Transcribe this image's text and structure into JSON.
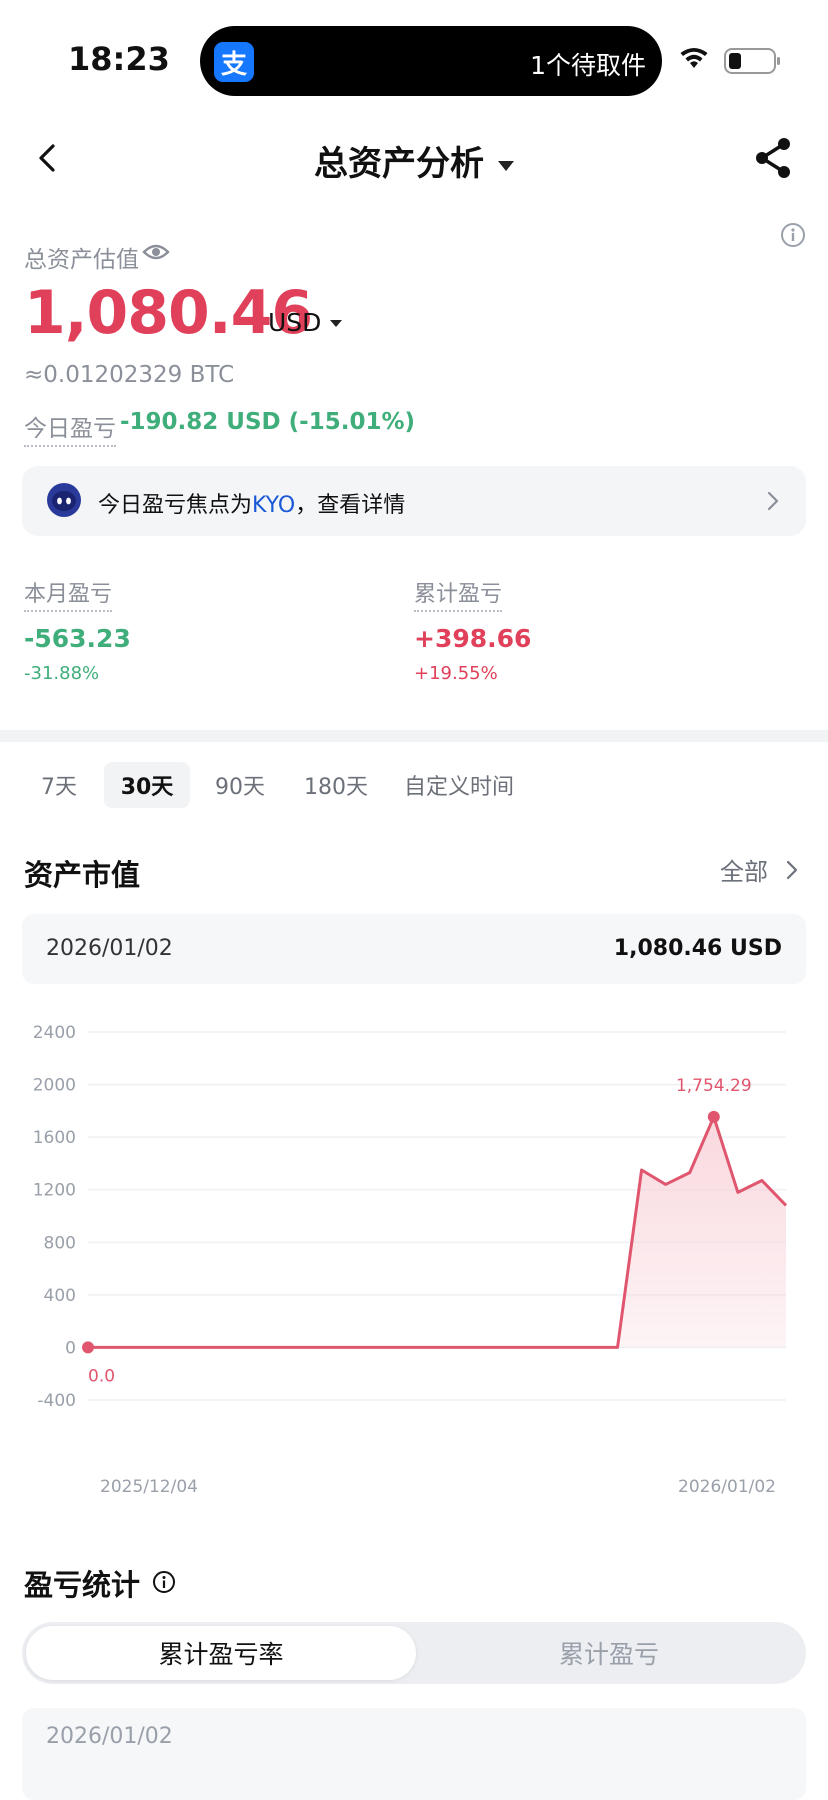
{
  "status_bar": {
    "time": "18:23",
    "island_text": "1个待取件",
    "app_icon_char": "支"
  },
  "nav": {
    "title": "总资产分析"
  },
  "summary": {
    "total_label": "总资产估值",
    "total_value": "1,080.46",
    "currency": "USD",
    "btc_equiv": "≈0.01202329 BTC",
    "today_label": "今日盈亏",
    "today_value": "-190.82 USD (-15.01%)"
  },
  "focus": {
    "prefix": "今日盈亏焦点为",
    "highlight": "KYO",
    "suffix": "，查看详情"
  },
  "stats": {
    "month": {
      "label": "本月盈亏",
      "value": "-563.23",
      "pct": "-31.88%"
    },
    "cumulative": {
      "label": "累计盈亏",
      "value": "+398.66",
      "pct": "+19.55%"
    }
  },
  "tabs": [
    "7天",
    "30天",
    "90天",
    "180天",
    "自定义时间"
  ],
  "active_tab": "30天",
  "asset_section": {
    "title": "资产市值",
    "all_label": "全部",
    "selected_date": "2026/01/02",
    "selected_value": "1,080.46 USD"
  },
  "chart_data": {
    "type": "area",
    "x_labels": [
      "2025/12/04",
      "2026/01/02"
    ],
    "y_ticks": [
      2400,
      2000,
      1600,
      1200,
      800,
      400,
      0,
      -400
    ],
    "ylim": [
      -400,
      2400
    ],
    "series": [
      {
        "values": [
          0,
          0,
          0,
          0,
          0,
          0,
          0,
          0,
          0,
          0,
          0,
          0,
          0,
          0,
          0,
          0,
          0,
          0,
          0,
          0,
          0,
          0,
          0,
          1350,
          1240,
          1330,
          1754.29,
          1180,
          1270,
          1080.46
        ]
      }
    ],
    "annotations": {
      "min_label": "0.0",
      "max_label": "1,754.29"
    },
    "colors": {
      "line": "#e0566e",
      "fill": "#f8d4da"
    }
  },
  "pl_section": {
    "title": "盈亏统计",
    "segments": [
      "累计盈亏率",
      "累计盈亏"
    ],
    "active_segment": "累计盈亏率",
    "partial_date": "2026/01/02"
  },
  "colors": {
    "loss": "#3fae7a",
    "gain": "#e0405a",
    "accent": "#1a58d6"
  }
}
